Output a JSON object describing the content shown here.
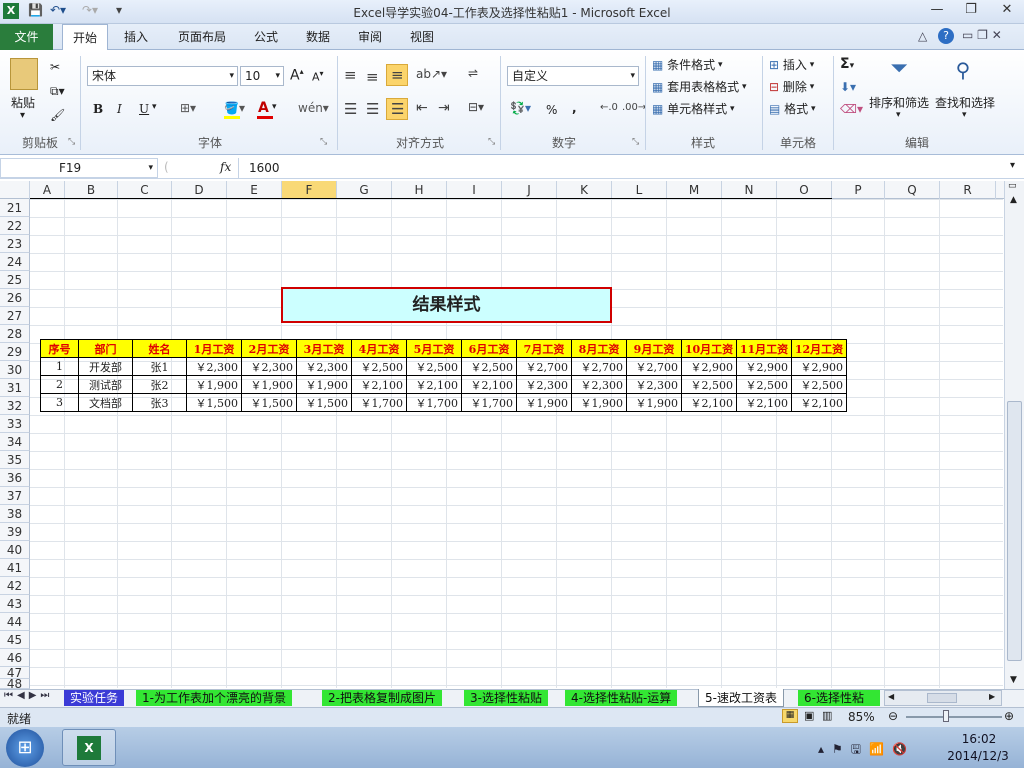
{
  "window": {
    "title": "Excel导学实验04-工作表及选择性粘贴1  -  Microsoft Excel"
  },
  "ribbon_tabs": [
    "文件",
    "开始",
    "插入",
    "页面布局",
    "公式",
    "数据",
    "审阅",
    "视图"
  ],
  "groups": {
    "clipboard": {
      "label": "剪贴板",
      "paste": "粘贴"
    },
    "font": {
      "label": "字体",
      "name": "宋体",
      "size": "10",
      "bold": "B",
      "italic": "I",
      "underline": "U",
      "grow": "A",
      "shrink": "A"
    },
    "alignment": {
      "label": "对齐方式"
    },
    "number": {
      "label": "数字",
      "format": "自定义",
      "percent": "%",
      "comma": ","
    },
    "styles": {
      "label": "样式",
      "conditional": "条件格式",
      "table": "套用表格格式",
      "cell": "单元格样式"
    },
    "cells": {
      "label": "单元格",
      "insert": "插入",
      "delete": "删除",
      "format": "格式"
    },
    "editing": {
      "label": "编辑",
      "sort": "排序和筛选",
      "find": "查找和选择",
      "sum": "Σ"
    }
  },
  "formula_bar": {
    "name_box": "F19",
    "fx": "fx",
    "value": "1600"
  },
  "columns": [
    "A",
    "B",
    "C",
    "D",
    "E",
    "F",
    "G",
    "H",
    "I",
    "J",
    "K",
    "L",
    "M",
    "N",
    "O",
    "P",
    "Q",
    "R"
  ],
  "rows": [
    "21",
    "22",
    "23",
    "24",
    "25",
    "26",
    "27",
    "28",
    "29",
    "30",
    "31",
    "32",
    "33",
    "34",
    "35",
    "36",
    "37",
    "38",
    "39",
    "40",
    "41",
    "42",
    "43",
    "44",
    "45",
    "46",
    "47",
    "48"
  ],
  "result_title": "结果样式",
  "table": {
    "headers": [
      "序号",
      "部门",
      "姓名",
      "1月工资",
      "2月工资",
      "3月工资",
      "4月工资",
      "5月工资",
      "6月工资",
      "7月工资",
      "8月工资",
      "9月工资",
      "10月工资",
      "11月工资",
      "12月工资"
    ],
    "rows": [
      [
        "1",
        "开发部",
        "张1",
        "￥2,300",
        "￥2,300",
        "￥2,300",
        "￥2,500",
        "￥2,500",
        "￥2,500",
        "￥2,700",
        "￥2,700",
        "￥2,700",
        "￥2,900",
        "￥2,900",
        "￥2,900"
      ],
      [
        "2",
        "测试部",
        "张2",
        "￥1,900",
        "￥1,900",
        "￥1,900",
        "￥2,100",
        "￥2,100",
        "￥2,100",
        "￥2,300",
        "￥2,300",
        "￥2,300",
        "￥2,500",
        "￥2,500",
        "￥2,500"
      ],
      [
        "3",
        "文档部",
        "张3",
        "￥1,500",
        "￥1,500",
        "￥1,500",
        "￥1,700",
        "￥1,700",
        "￥1,700",
        "￥1,900",
        "￥1,900",
        "￥1,900",
        "￥2,100",
        "￥2,100",
        "￥2,100"
      ]
    ]
  },
  "sheet_tabs": [
    "实验任务",
    "1-为工作表加个漂亮的背景",
    "2-把表格复制成图片",
    "3-选择性粘贴",
    "4-选择性粘贴-运算",
    "5-速改工资表",
    "6-选择性粘"
  ],
  "status": {
    "ready": "就绪",
    "zoom": "85%"
  },
  "taskbar": {
    "time": "16:02",
    "date": "2014/12/3"
  },
  "colors": {
    "header_bg": "#ffff00",
    "header_text": "#e00000",
    "title_bg": "#ccffff",
    "title_border": "#d00000",
    "file_tab": "#2a7d3c"
  }
}
